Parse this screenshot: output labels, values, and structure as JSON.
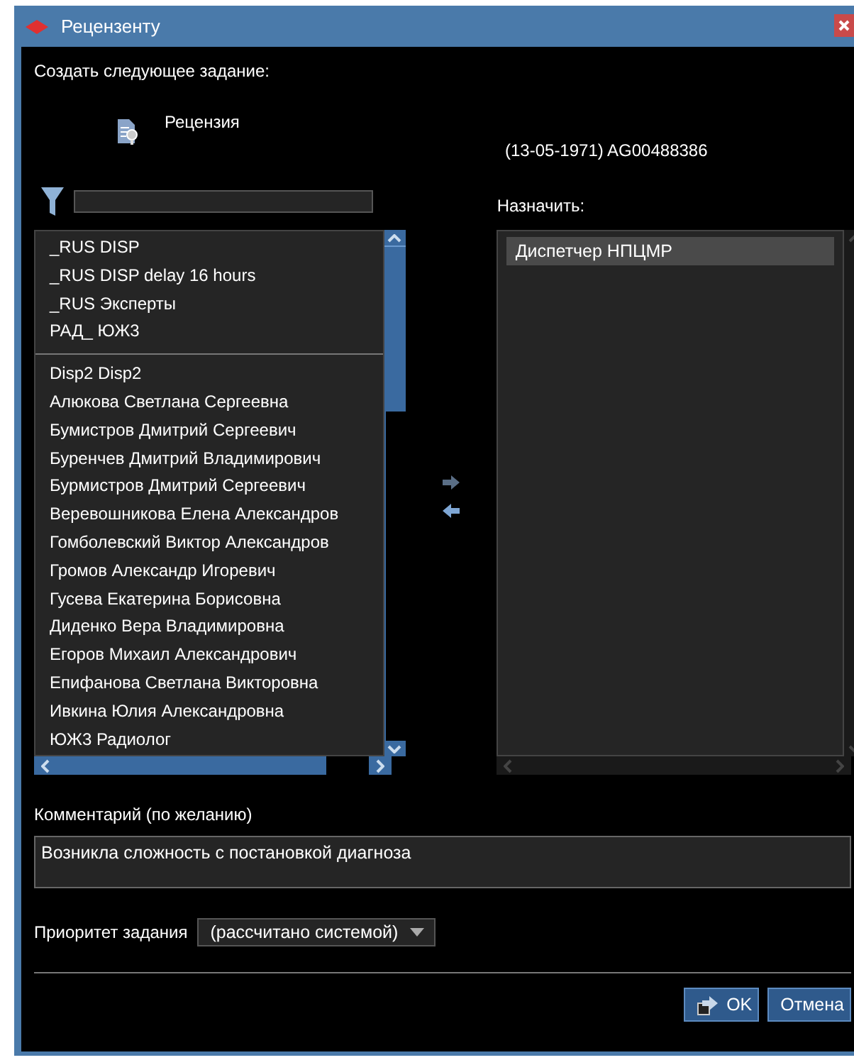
{
  "window": {
    "title": "Рецензенту"
  },
  "heading": "Создать следующее задание:",
  "task": {
    "name": "Рецензия",
    "patient": "(13-05-1971) AG00488386"
  },
  "available": {
    "groups": [
      [
        "_RUS DISP",
        "_RUS DISP delay 16 hours",
        "_RUS Эксперты",
        "РАД_ ЮЖ3"
      ],
      [
        "Disp2 Disp2",
        "Алюкова Светлана Сергеевна",
        "Бумистров Дмитрий Сергеевич",
        "Буренчев Дмитрий Владимирович",
        "Бурмистров Дмитрий Сергеевич",
        "Веревошникова Елена Александров",
        "Гомболевский Виктор Александров",
        "Громов Александр Игоревич",
        "Гусева Екатерина Борисовна",
        "Диденко Вера Владимировна",
        "Егоров Михаил Александрович",
        "Епифанова Светлана Викторовна",
        "Ивкина Юлия Александровна",
        "ЮЖ3 Радиолог"
      ]
    ]
  },
  "assign": {
    "label": "Назначить:",
    "items": [
      {
        "name": "Диспетчер НПЦМР",
        "selected": true
      }
    ]
  },
  "comment": {
    "label": "Комментарий (по желанию)",
    "value": "Возникла сложность с постановкой диагноза"
  },
  "priority": {
    "label": "Приоритет задания",
    "value": "(рассчитано системой)"
  },
  "buttons": [
    {
      "kind": "ok",
      "label": "OK"
    },
    {
      "kind": "cancel",
      "label": "Отмена"
    }
  ]
}
